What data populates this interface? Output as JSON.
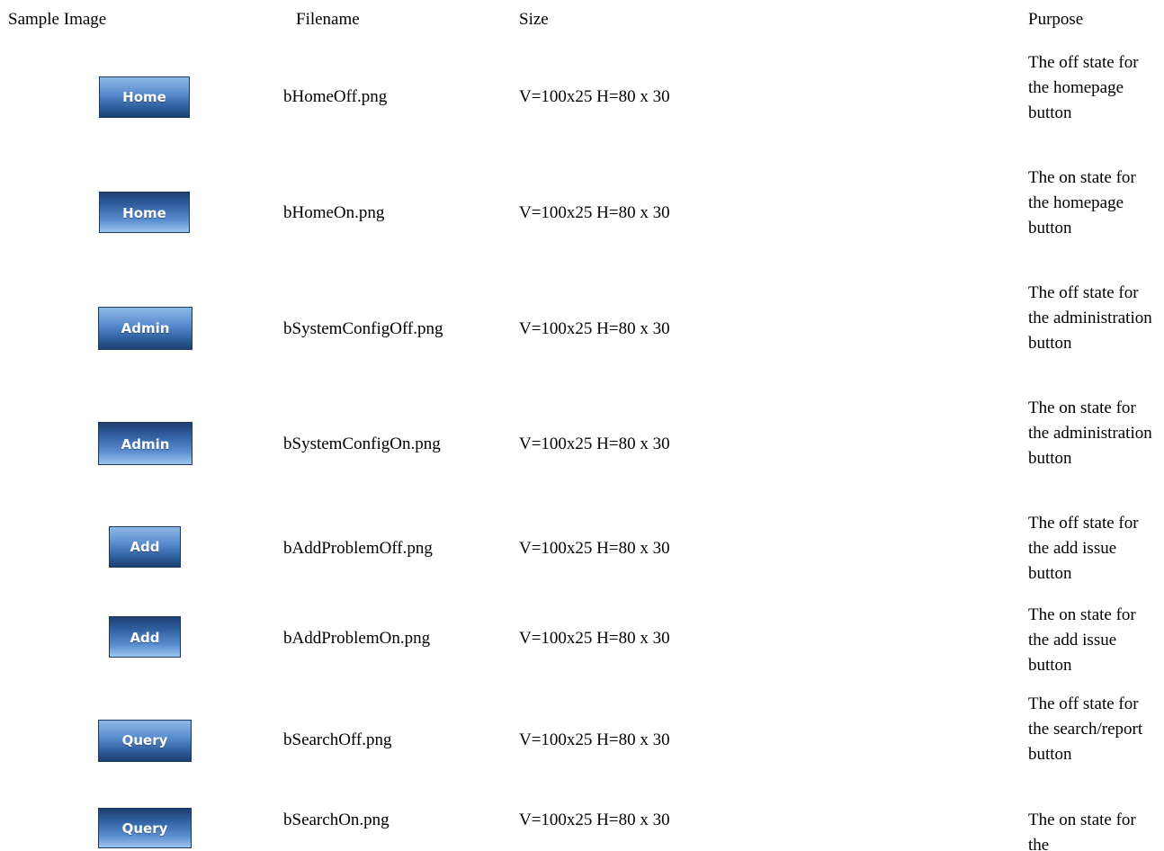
{
  "table": {
    "headers": {
      "sample_image": "Sample Image",
      "filename": "Filename",
      "size": "Size",
      "purpose": "Purpose"
    },
    "rows": [
      {
        "button_label": "Home",
        "state": "off",
        "filename": "bHomeOff.png",
        "size": "V=100x25 H=80 x 30",
        "purpose": "The off state for the homepage button"
      },
      {
        "button_label": "Home",
        "state": "on",
        "filename": "bHomeOn.png",
        "size": "V=100x25 H=80 x 30",
        "purpose": "The on state for the homepage button"
      },
      {
        "button_label": "Admin",
        "state": "off",
        "filename": "bSystemConfigOff.png",
        "size": "V=100x25 H=80 x 30",
        "purpose": "The off state for the administration button"
      },
      {
        "button_label": "Admin",
        "state": "on",
        "filename": "bSystemConfigOn.png",
        "size": "V=100x25 H=80 x 30",
        "purpose": "The on state for the administration button"
      },
      {
        "button_label": "Add",
        "state": "off",
        "filename": "bAddProblemOff.png",
        "size": "V=100x25 H=80 x 30",
        "purpose": "The off state for the add issue button"
      },
      {
        "button_label": "Add",
        "state": "on",
        "filename": "bAddProblemOn.png",
        "size": "V=100x25 H=80 x 30",
        "purpose": "The on state for the add issue button"
      },
      {
        "button_label": "Query",
        "state": "off",
        "filename": "bSearchOff.png",
        "size": "V=100x25 H=80 x 30",
        "purpose": "The off state for the search/report button"
      },
      {
        "button_label": "Query",
        "state": "on",
        "filename": "bSearchOn.png",
        "size": "V=100x25 H=80 x 30",
        "purpose": "The on state for the"
      }
    ]
  },
  "colors": {
    "button_dark": "#1c3f72",
    "button_light": "#8fb8e6"
  }
}
